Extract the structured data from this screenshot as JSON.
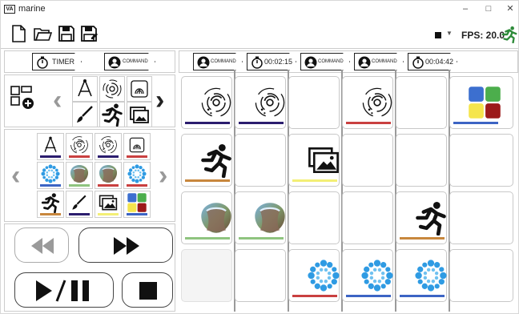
{
  "window": {
    "app_icon_text": "VA",
    "title": "marine",
    "minimize": "–",
    "maximize": "□",
    "close": "✕"
  },
  "toolbar": {
    "fps_label": "FPS: 20.0"
  },
  "left_panel": {
    "timer_label": "TIMER",
    "command_label": "COMMAND",
    "palette_colors": [
      "#2b1d6e",
      "#c94040",
      "#f3ef75",
      "#c8873d",
      "#8fc47f",
      "#3c64c4"
    ]
  },
  "timeline": {
    "headers": [
      {
        "type": "command",
        "label": "COMMAND"
      },
      {
        "type": "timer",
        "label": "00:02:15"
      },
      {
        "type": "command",
        "label": "COMMAND"
      },
      {
        "type": "command",
        "label": "COMMAND"
      },
      {
        "type": "timer",
        "label": "00:04:42"
      }
    ],
    "colors": {
      "navy": "#2b1d6e",
      "red": "#c94040",
      "yellow": "#f3ef75",
      "orange": "#c8873d",
      "green": "#8fc47f",
      "blue": "#3c64c4"
    }
  }
}
